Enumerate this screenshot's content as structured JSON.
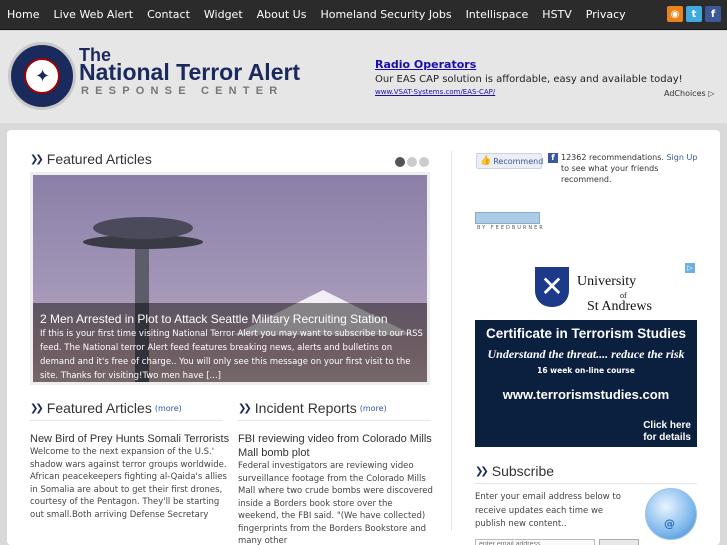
{
  "nav": {
    "items": [
      "Home",
      "Live Web Alert",
      "Contact",
      "Widget",
      "About Us",
      "Homeland Security Jobs",
      "Intellispace",
      "HSTV",
      "Privacy"
    ]
  },
  "header": {
    "logo_title_1": "The",
    "logo_title_2": "National Terror Alert",
    "logo_sub": "RESPONSE CENTER",
    "ad_title": "Radio Operators",
    "ad_text": "Our EAS CAP solution is affordable, easy and available today!",
    "ad_url": "www.VSAT-Systems.com/EAS-CAP/",
    "adchoices": "AdChoices ▷"
  },
  "featured": {
    "heading": "Featured Articles",
    "slide_title": "2 Men Arrested in Plot to Attack Seattle Military Recruiting Station",
    "slide_text": "If this is your first time visiting National Terror Alert you may want to subscribe to our RSS feed. The National terror Alert feed features breaking news, alerts and bulletins on demand and it's free of charge.. You will only see this message on your first visit to the site. Thanks for visiting!Two men have [...]"
  },
  "col1": {
    "heading": "Featured Articles",
    "more": "(more)",
    "article_title": "New Bird of Prey Hunts Somali Terrorists",
    "article_text": "Welcome to the next expansion of the U.S.' shadow wars against terror groups worldwide. African peacekeepers fighting al-Qaida's allies in Somalia are about to get their first drones, courtesy of the Pentagon. They'll be starting out small.Both arriving Defense Secretary"
  },
  "col2": {
    "heading": "Incident Reports",
    "more": "(more)",
    "article_title": "FBI reviewing video from Colorado Mills Mall bomb plot",
    "article_text": "Federal investigators are reviewing video surveillance footage from the Colorado Mills Mall where two crude bombs were discovered inside a Borders book store over the weekend, the FBI said. \"(We have collected) fingerprints from the Borders Bookstore and many other"
  },
  "sidebar": {
    "recommend_label": "Recommend",
    "rec_text": "12362 recommendations.",
    "signup": "Sign Up",
    "rec_text2": "to see what your friends recommend.",
    "feedburner": "BY FEEDBURNER",
    "ad": {
      "uni1": "University",
      "uni_of": "of",
      "uni2": "St Andrews",
      "cert": "Certificate in Terrorism Studies",
      "understand": "Understand the threat.... reduce the risk",
      "weeks": "16 week on-line course",
      "site": "www.terrorismstudies.com",
      "click1": "Click here",
      "click2": "for details"
    },
    "subscribe_heading": "Subscribe",
    "subscribe_text": "Enter your email address below to receive updates each time we publish new content..",
    "email_placeholder": "enter email address"
  }
}
